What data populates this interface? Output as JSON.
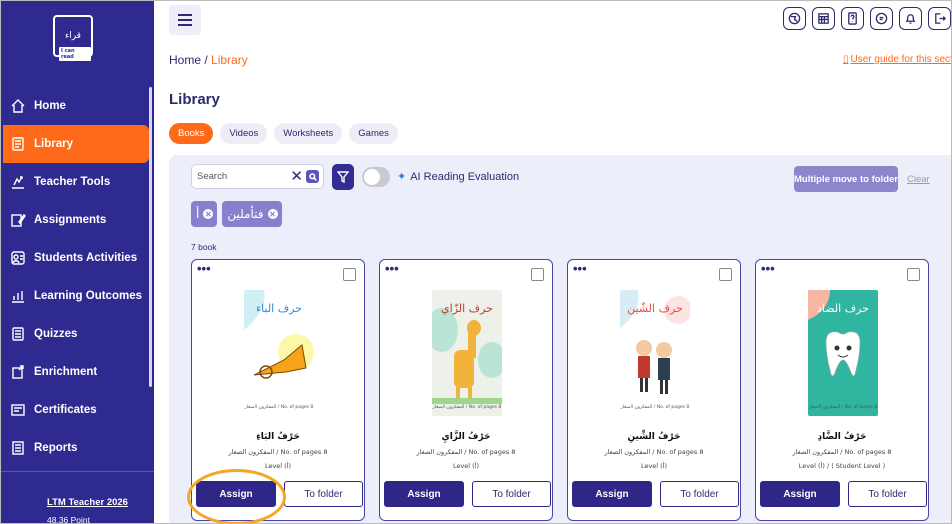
{
  "logo": {
    "text": "قراء",
    "tag": "I can read"
  },
  "sidebar": {
    "items": [
      {
        "label": "Home",
        "icon": "home-icon"
      },
      {
        "label": "Library",
        "icon": "book-icon",
        "active": true
      },
      {
        "label": "Teacher Tools",
        "icon": "tools-icon"
      },
      {
        "label": "Assignments",
        "icon": "pencil-icon"
      },
      {
        "label": "Students Activities",
        "icon": "activities-icon"
      },
      {
        "label": "Learning Outcomes",
        "icon": "outcomes-icon"
      },
      {
        "label": "Quizzes",
        "icon": "quiz-icon"
      },
      {
        "label": "Enrichment",
        "icon": "enrichment-icon"
      },
      {
        "label": "Certificates",
        "icon": "certificate-icon"
      },
      {
        "label": "Reports",
        "icon": "reports-icon"
      }
    ],
    "user": "LTM Teacher 2026",
    "points": "48.36 Point"
  },
  "header": {
    "breadcrumb_home": "Home",
    "breadcrumb_sep": "/",
    "breadcrumb_current": "Library",
    "guide": "User guide for this section",
    "title": "Library"
  },
  "tabs": [
    {
      "label": "Books",
      "active": true
    },
    {
      "label": "Videos"
    },
    {
      "label": "Worksheets"
    },
    {
      "label": "Games"
    }
  ],
  "toolbar": {
    "search_placeholder": "Search",
    "ai_label": "AI Reading Evaluation",
    "multi_move": "Multiple move to folder",
    "clear": "Clear"
  },
  "chips": [
    {
      "label": "أ"
    },
    {
      "label": "فتأملين"
    }
  ],
  "count": "7 book",
  "cards": [
    {
      "cover_title": "حرف الباء",
      "title": "حَرْفُ البَاءِ",
      "meta": "المفكرون الصغار / No. of pages 8",
      "level": "Level (أ)",
      "assign": "Assign",
      "folder": "To folder",
      "bg": "#ffffff",
      "title_color": "#2b8be0"
    },
    {
      "cover_title": "حرف الزّاي",
      "title": "حَرْفُ الزَّايِ",
      "meta": "المفكرون الصغار / No. of pages 8",
      "level": "Level (أ)",
      "assign": "Assign",
      "folder": "To folder",
      "bg": "#eef1ea",
      "title_color": "#c0392b"
    },
    {
      "cover_title": "حرف الشّين",
      "title": "حَرْفُ الشِّينِ",
      "meta": "المفكرون الصغار / No. of pages 8",
      "level": "Level (أ)",
      "assign": "Assign",
      "folder": "To folder",
      "bg": "#ffffff",
      "title_color": "#e74c3c"
    },
    {
      "cover_title": "حرف الضاد",
      "title": "حَرْفُ الضَّادِ",
      "meta": "المفكرون الصغار / No. of pages 8",
      "level": "Level (أ) / ( Student Level )",
      "assign": "Assign",
      "folder": "To folder",
      "bg": "#2fb5a0",
      "title_color": "#ffffff"
    }
  ]
}
